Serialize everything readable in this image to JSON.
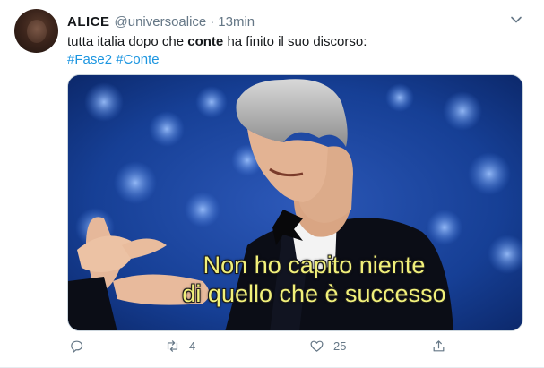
{
  "tweet": {
    "author_name": "ALICE",
    "author_handle": "@universoalice",
    "separator": "·",
    "time": "13min",
    "text_before": "tutta italia dopo che ",
    "text_bold": "conte",
    "text_after": " ha finito il suo discorso:",
    "hashtags": [
      "#Fase2",
      "#Conte"
    ],
    "media": {
      "subtitle_line1": "Non ho capito niente",
      "subtitle_line2": "di quello che è successo"
    },
    "actions": {
      "reply_icon": "reply-icon",
      "retweet_icon": "retweet-icon",
      "retweet_count": "4",
      "like_icon": "heart-icon",
      "like_count": "25",
      "share_icon": "share-icon"
    }
  },
  "colors": {
    "link": "#1b95e0",
    "secondary_text": "#657786",
    "subtitle": "#f1f07a"
  }
}
